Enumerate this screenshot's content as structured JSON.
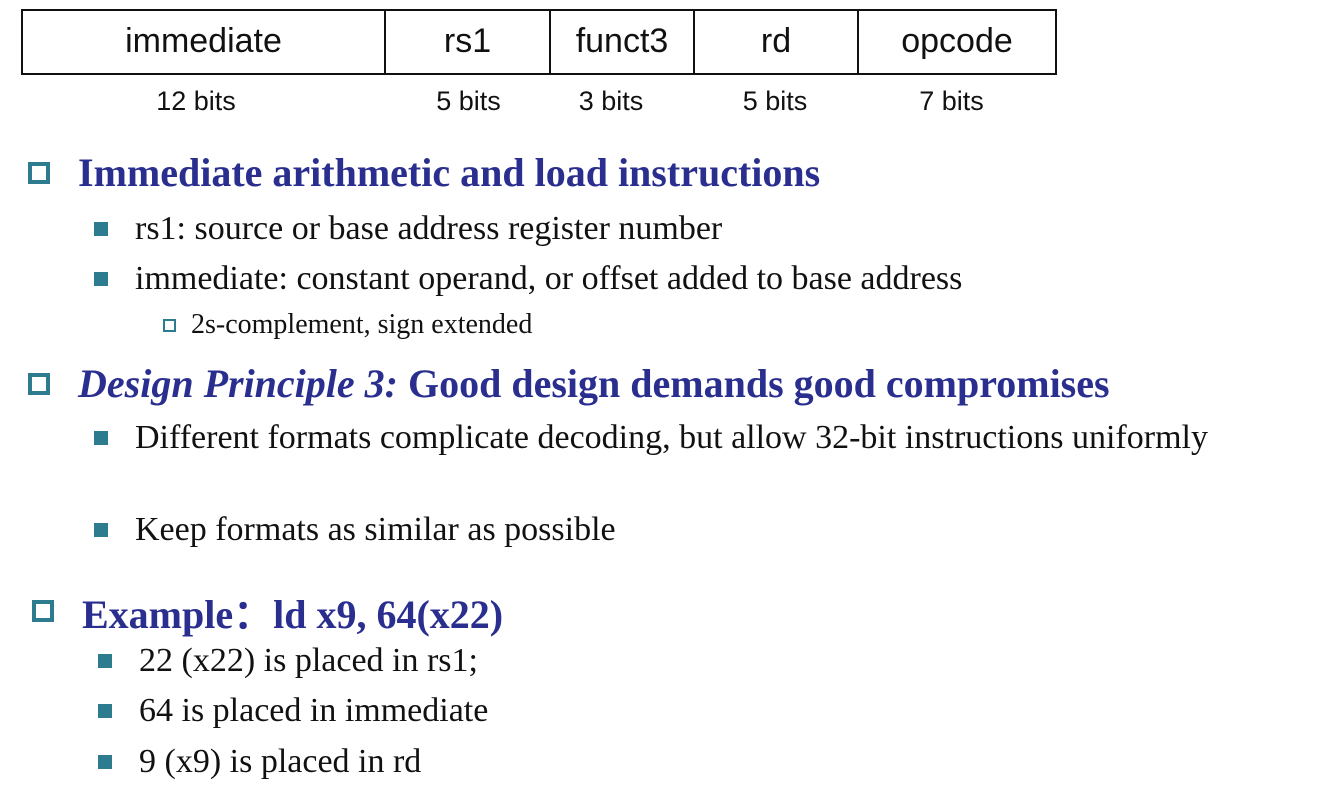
{
  "format_table": {
    "fields": [
      {
        "label": "immediate",
        "bits": "12 bits"
      },
      {
        "label": "rs1",
        "bits": "5 bits"
      },
      {
        "label": "funct3",
        "bits": "3 bits"
      },
      {
        "label": "rd",
        "bits": "5 bits"
      },
      {
        "label": "opcode",
        "bits": "7 bits"
      }
    ]
  },
  "sections": [
    {
      "heading": "Immediate arithmetic and load instructions",
      "bullets": [
        "rs1: source or base address register number",
        "immediate: constant operand, or offset added to base address"
      ],
      "sub_bullets": [
        "2s-complement, sign extended"
      ]
    },
    {
      "heading_italic": "Design Principle 3:",
      "heading_rest": " Good design demands good compromises",
      "bullets": [
        "Different formats complicate decoding, but allow 32-bit instructions uniformly",
        "Keep formats as similar as possible"
      ]
    },
    {
      "heading": "Example：ld x9, 64(x22)",
      "bullets": [
        "22 (x22) is placed in rs1;",
        "64 is placed in immediate",
        "9 (x9) is placed in rd"
      ]
    }
  ],
  "colors": {
    "heading": "#2a2f8f",
    "bullet_marker": "#2c7b8f",
    "text": "#111111"
  }
}
